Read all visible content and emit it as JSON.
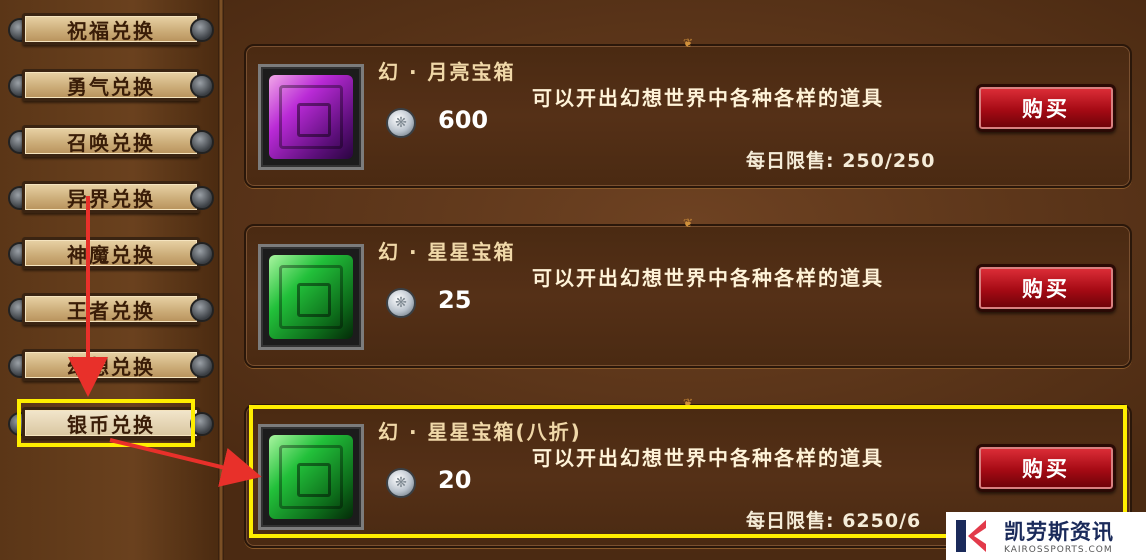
{
  "sidebar": {
    "tabs": [
      {
        "label": "祝福兑换"
      },
      {
        "label": "勇气兑换"
      },
      {
        "label": "召唤兑换"
      },
      {
        "label": "异界兑换"
      },
      {
        "label": "神魔兑换"
      },
      {
        "label": "王者兑换"
      },
      {
        "label": "幻想兑换"
      },
      {
        "label": "银币兑换",
        "selected": true
      }
    ]
  },
  "items": [
    {
      "title": "幻 · 月亮宝箱",
      "description": "可以开出幻想世界中各种各样的道具",
      "price": "600",
      "limit": "每日限售: 250/250",
      "buy_label": "购买",
      "icon": "purple-treasure-box-icon"
    },
    {
      "title": "幻 · 星星宝箱",
      "description": "可以开出幻想世界中各种各样的道具",
      "price": "25",
      "limit": "",
      "buy_label": "购买",
      "icon": "green-treasure-box-icon"
    },
    {
      "title": "幻 · 星星宝箱(八折)",
      "description": "可以开出幻想世界中各种各样的道具",
      "price": "20",
      "limit": "每日限售: 6250/6",
      "buy_label": "购买",
      "icon": "green-treasure-box-icon"
    }
  ],
  "currency_icon": "silver-coin-icon",
  "watermark": {
    "name": "凯劳斯资讯",
    "sub": "KAIROSSPORTS.COM"
  },
  "colors": {
    "highlight": "#ffee00",
    "buy_button": "#b0101a",
    "annotation_arrow": "#e8302a"
  }
}
